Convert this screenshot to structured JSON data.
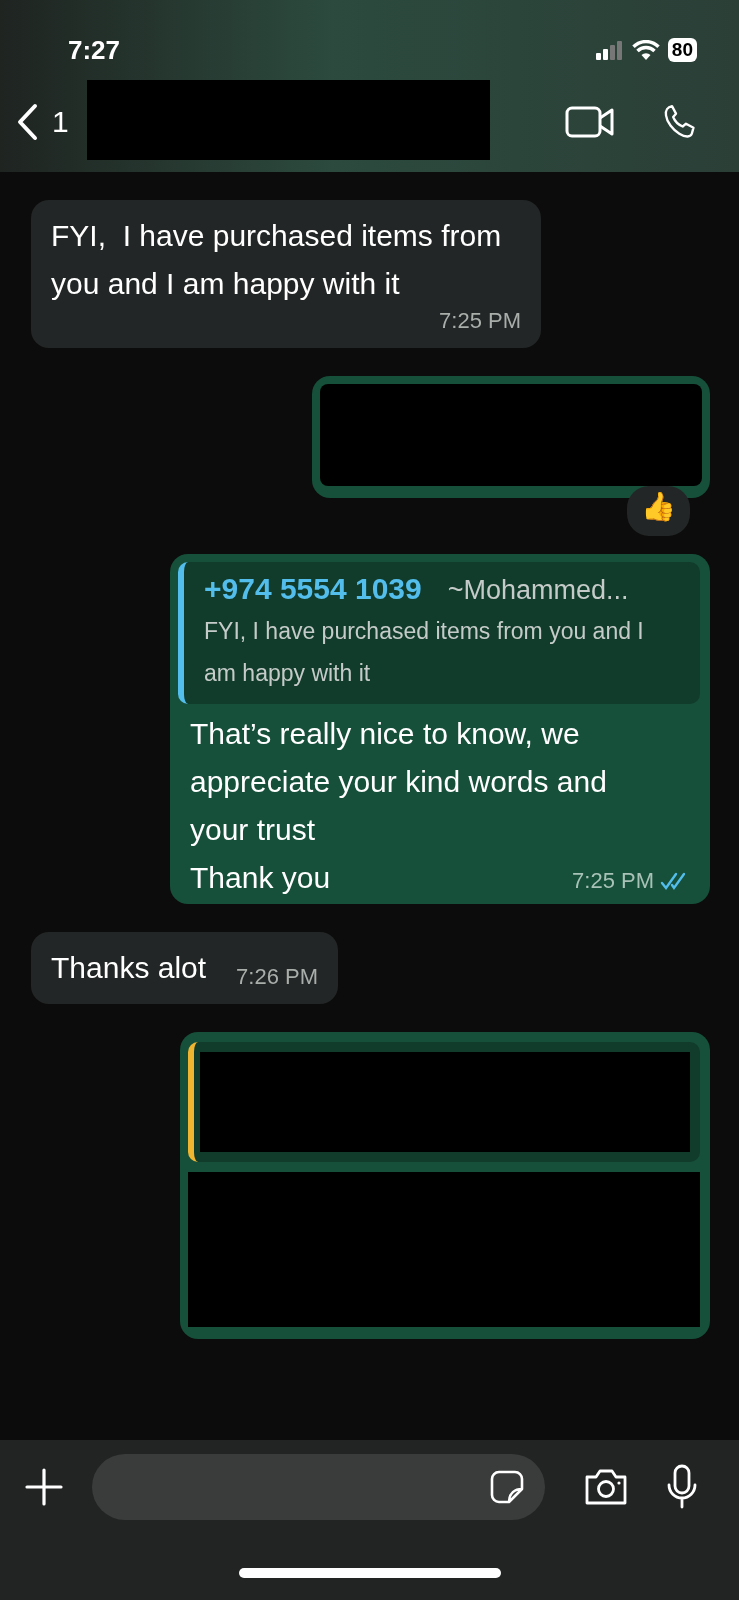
{
  "status_bar": {
    "time": "7:27",
    "battery": "80"
  },
  "header": {
    "back_count": "1"
  },
  "messages": [
    {
      "kind": "text",
      "outgoing": false,
      "text": "FYI,  I have purchased items from you and I am happy with it",
      "time": "7:25 PM"
    },
    {
      "kind": "redacted",
      "outgoing": true,
      "reaction": "👍"
    },
    {
      "kind": "reply",
      "outgoing": true,
      "quote_sender": "+974 5554 1039",
      "quote_name": "~Mohammed...",
      "quote_text": "FYI,  I have purchased items from you and I am happy with it",
      "lines": [
        "That’s really nice to know, we appreciate your kind words and your trust",
        "Thank you"
      ],
      "time": "7:25 PM",
      "read": true
    },
    {
      "kind": "text",
      "outgoing": false,
      "text": "Thanks alot",
      "time": "7:26 PM"
    },
    {
      "kind": "redacted_reply",
      "outgoing": true
    }
  ]
}
